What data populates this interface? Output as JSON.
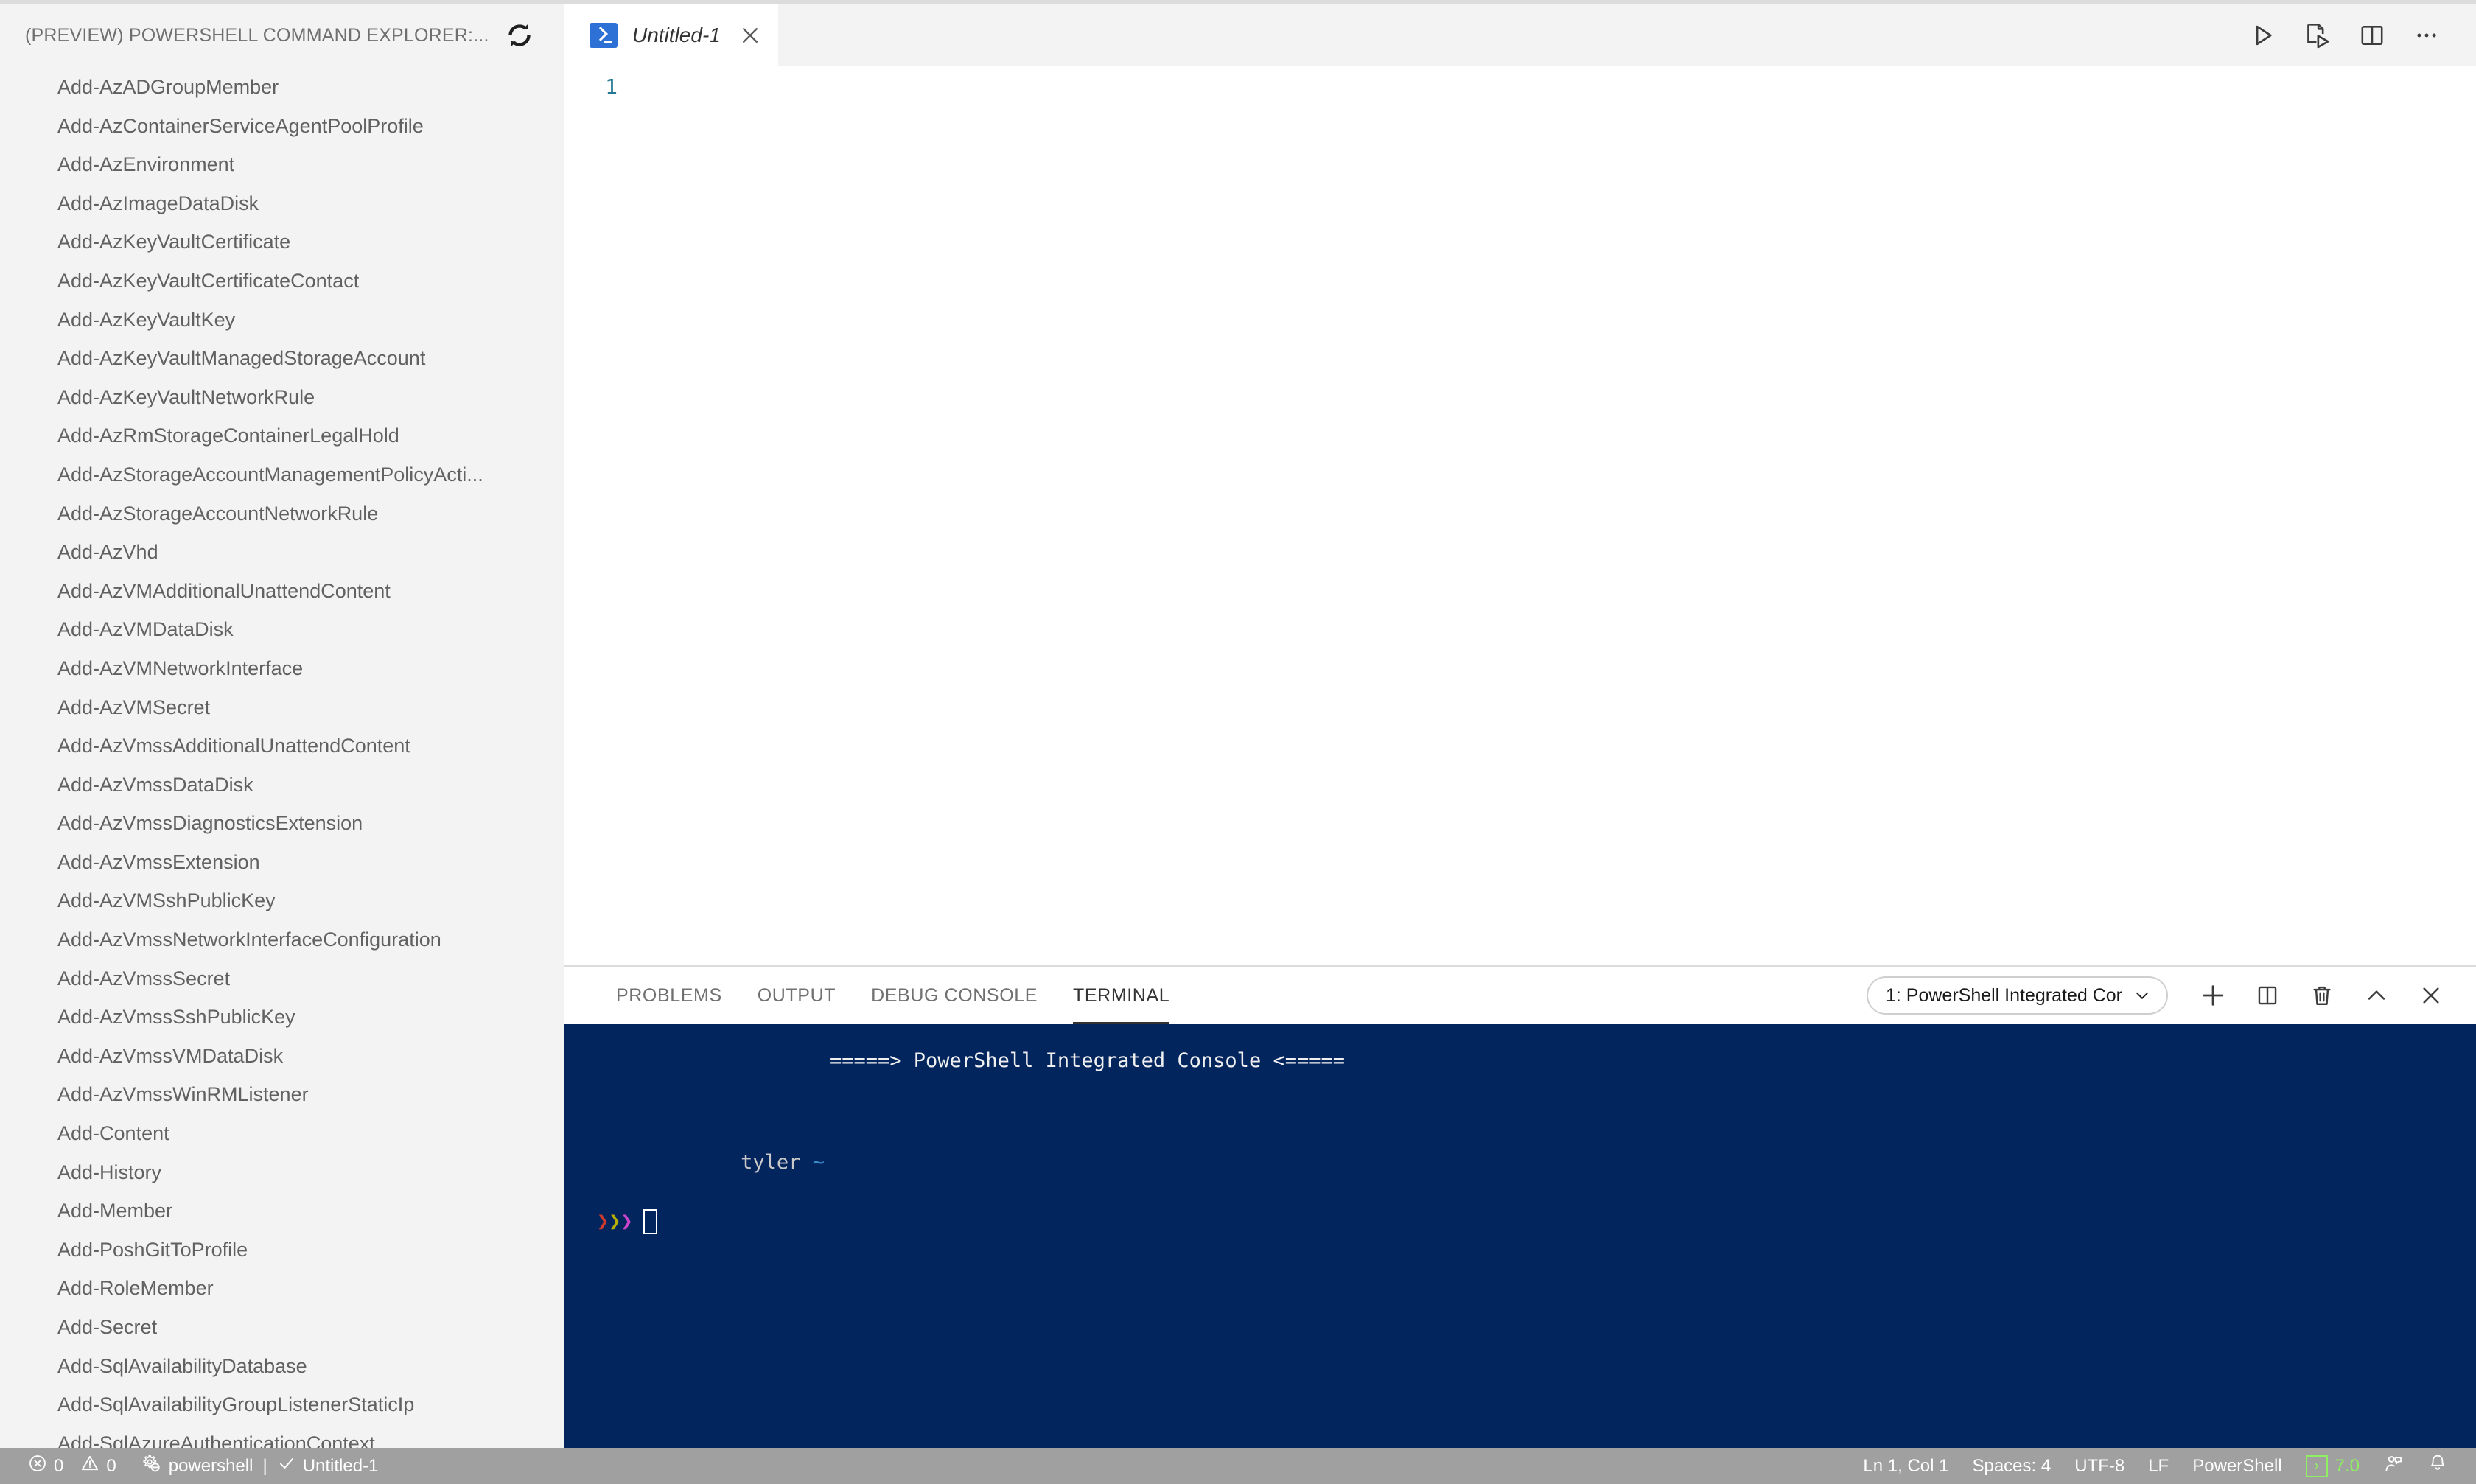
{
  "sidebar": {
    "title": "(PREVIEW) POWERSHELL COMMAND EXPLORER:...",
    "refresh_icon": "refresh-icon",
    "commands": [
      "Add-AzADGroupMember",
      "Add-AzContainerServiceAgentPoolProfile",
      "Add-AzEnvironment",
      "Add-AzImageDataDisk",
      "Add-AzKeyVaultCertificate",
      "Add-AzKeyVaultCertificateContact",
      "Add-AzKeyVaultKey",
      "Add-AzKeyVaultManagedStorageAccount",
      "Add-AzKeyVaultNetworkRule",
      "Add-AzRmStorageContainerLegalHold",
      "Add-AzStorageAccountManagementPolicyActi...",
      "Add-AzStorageAccountNetworkRule",
      "Add-AzVhd",
      "Add-AzVMAdditionalUnattendContent",
      "Add-AzVMDataDisk",
      "Add-AzVMNetworkInterface",
      "Add-AzVMSecret",
      "Add-AzVmssAdditionalUnattendContent",
      "Add-AzVmssDataDisk",
      "Add-AzVmssDiagnosticsExtension",
      "Add-AzVmssExtension",
      "Add-AzVMSshPublicKey",
      "Add-AzVmssNetworkInterfaceConfiguration",
      "Add-AzVmssSecret",
      "Add-AzVmssSshPublicKey",
      "Add-AzVmssVMDataDisk",
      "Add-AzVmssWinRMListener",
      "Add-Content",
      "Add-History",
      "Add-Member",
      "Add-PoshGitToProfile",
      "Add-RoleMember",
      "Add-Secret",
      "Add-SqlAvailabilityDatabase",
      "Add-SqlAvailabilityGroupListenerStaticIp",
      "Add-SqlAzureAuthenticationContext"
    ]
  },
  "editor": {
    "tab": {
      "label": "Untitled-1",
      "icon": "powershell-file-icon",
      "close_icon": "close-icon"
    },
    "actions": [
      {
        "name": "run-button",
        "icon": "play-icon"
      },
      {
        "name": "run-file-button",
        "icon": "run-file-icon"
      },
      {
        "name": "split-editor-button",
        "icon": "split-editor-icon"
      },
      {
        "name": "more-actions-button",
        "icon": "ellipsis-icon"
      }
    ],
    "line_numbers": [
      "1"
    ],
    "lines": [
      ""
    ]
  },
  "panel": {
    "tabs": [
      {
        "label": "PROBLEMS",
        "active": false
      },
      {
        "label": "OUTPUT",
        "active": false
      },
      {
        "label": "DEBUG CONSOLE",
        "active": false
      },
      {
        "label": "TERMINAL",
        "active": true
      }
    ],
    "terminal_select": {
      "value": "1: PowerShell Integrated Cor",
      "chevron_icon": "chevron-down-icon"
    },
    "actions": [
      {
        "name": "new-terminal-button",
        "icon": "plus-icon"
      },
      {
        "name": "split-terminal-button",
        "icon": "split-icon"
      },
      {
        "name": "kill-terminal-button",
        "icon": "trash-icon"
      },
      {
        "name": "maximize-panel-button",
        "icon": "chevron-up-icon"
      },
      {
        "name": "close-panel-button",
        "icon": "close-icon"
      }
    ]
  },
  "terminal": {
    "banner": "=====> PowerShell Integrated Console <=====",
    "prompt_user": "tyler",
    "prompt_path": "~",
    "prompt_chevrons": [
      "❯",
      "❯",
      "❯"
    ],
    "cursor": "block-cursor"
  },
  "statusbar": {
    "errors": {
      "icon": "error-icon",
      "count": "0"
    },
    "warnings": {
      "icon": "warning-icon",
      "count": "0"
    },
    "extension": {
      "icon": "gear-minus-icon",
      "label": "powershell"
    },
    "separator": "|",
    "session": {
      "icon": "check-icon",
      "label": "Untitled-1"
    },
    "cursor_position": "Ln 1, Col 1",
    "indentation": "Spaces: 4",
    "encoding": "UTF-8",
    "eol": "LF",
    "language": "PowerShell",
    "pwsh_version": "7.0",
    "pwsh_prompt_glyph": "›",
    "feedback_icon": "person-feedback-icon",
    "bell_icon": "bell-icon"
  },
  "colors": {
    "sidebar_bg": "#f3f3f3",
    "terminal_bg": "#03255e",
    "statusbar_bg": "#a0a0a0",
    "accent_green": "#90ee62",
    "line_number": "#237893",
    "tab_accent_blue": "#2d70d6"
  }
}
